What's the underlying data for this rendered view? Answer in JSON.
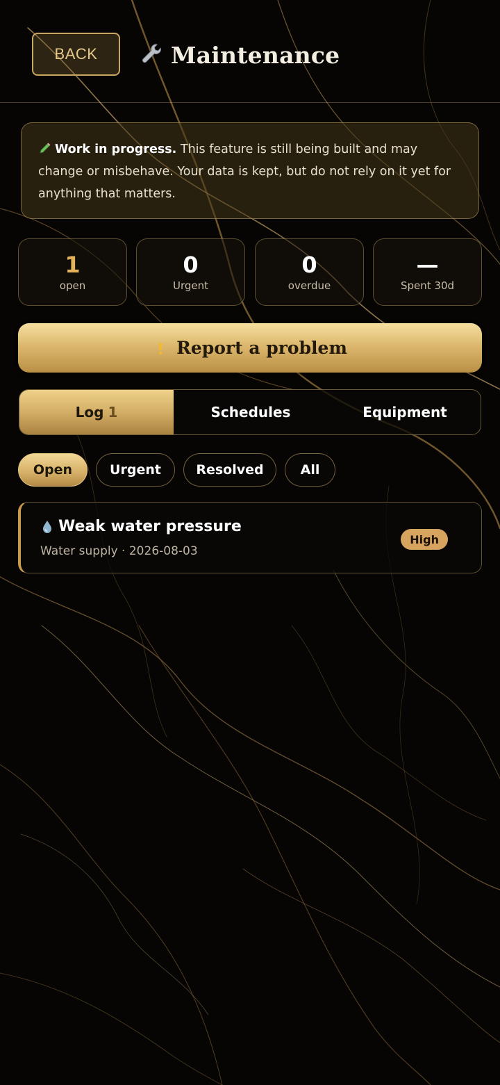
{
  "header": {
    "back_label": "BACK",
    "title": "Maintenance",
    "title_icon": "wrench-icon"
  },
  "notice": {
    "icon": "pencil-icon",
    "bold": "Work in progress.",
    "text": " This feature is still being built and may change or misbehave. Your data is kept, but do not rely on it yet for anything that matters."
  },
  "stats": [
    {
      "value": "1",
      "label": "open"
    },
    {
      "value": "0",
      "label": "Urgent"
    },
    {
      "value": "0",
      "label": "overdue"
    },
    {
      "value": "—",
      "label": "Spent 30d"
    }
  ],
  "report_button": {
    "icon": "warning-icon",
    "label": "Report a problem"
  },
  "tabs": [
    {
      "label": "Log",
      "count": "1",
      "active": true
    },
    {
      "label": "Schedules",
      "count": "",
      "active": false
    },
    {
      "label": "Equipment",
      "count": "",
      "active": false
    }
  ],
  "filters": [
    {
      "label": "Open",
      "active": true
    },
    {
      "label": "Urgent",
      "active": false
    },
    {
      "label": "Resolved",
      "active": false
    },
    {
      "label": "All",
      "active": false
    }
  ],
  "issues": [
    {
      "icon": "droplet-icon",
      "title": "Weak water pressure",
      "meta": "Water supply · 2026-08-03",
      "priority": "High"
    }
  ],
  "colors": {
    "gold_accent": "#d6a45e",
    "background": "#050403",
    "open_stat": "#e3b25a"
  }
}
